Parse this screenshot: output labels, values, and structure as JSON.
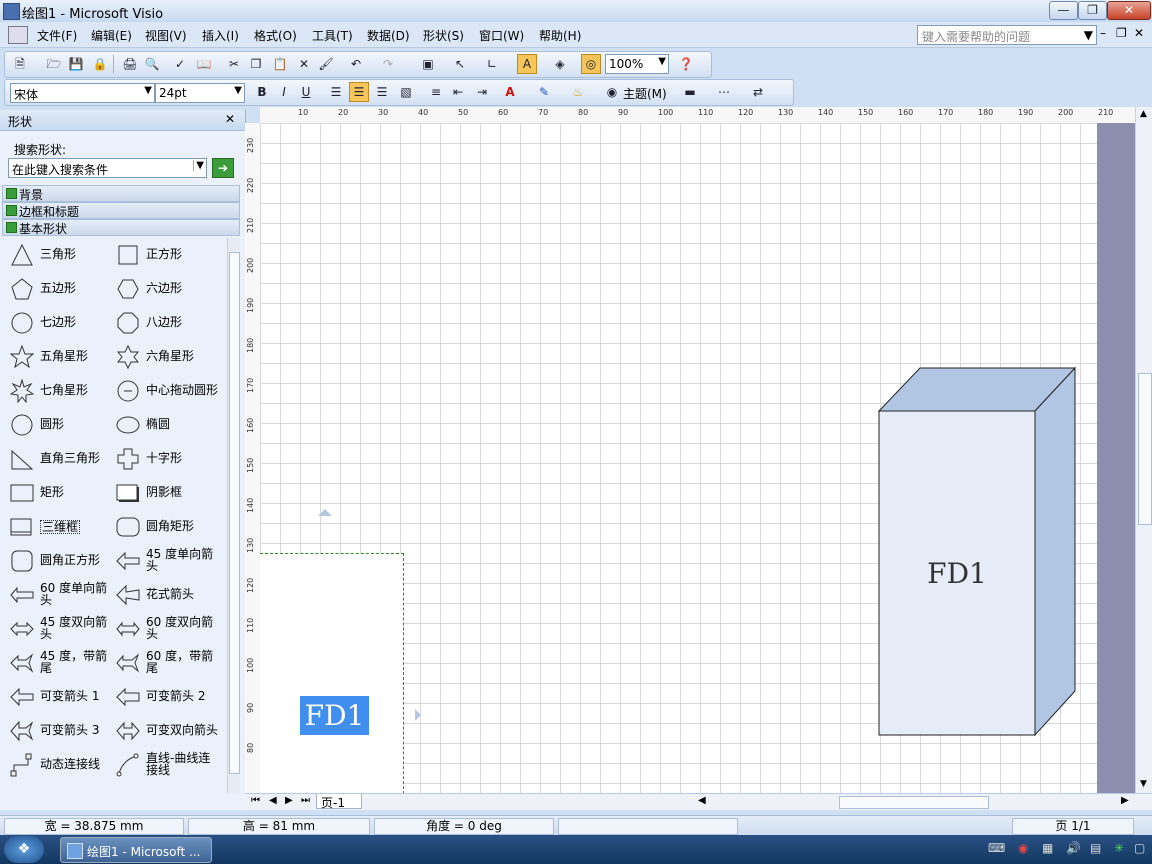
{
  "window": {
    "title": "绘图1 - Microsoft Visio"
  },
  "menu": {
    "items": [
      "文件(F)",
      "编辑(E)",
      "视图(V)",
      "插入(I)",
      "格式(O)",
      "工具(T)",
      "数据(D)",
      "形状(S)",
      "窗口(W)",
      "帮助(H)"
    ],
    "help_placeholder": "键入需要帮助的问题"
  },
  "toolbar": {
    "zoom": "100%",
    "font_name": "宋体",
    "font_size": "24pt",
    "theme_label": "主题(M)"
  },
  "panel": {
    "title": "形状",
    "search_label": "搜索形状:",
    "search_placeholder": "在此键入搜索条件",
    "stencils": [
      "背景",
      "边框和标题",
      "基本形状"
    ],
    "shapes": [
      {
        "l": "三角形",
        "r": "正方形"
      },
      {
        "l": "五边形",
        "r": "六边形"
      },
      {
        "l": "七边形",
        "r": "八边形"
      },
      {
        "l": "五角星形",
        "r": "六角星形"
      },
      {
        "l": "七角星形",
        "r": "中心拖动圆形"
      },
      {
        "l": "圆形",
        "r": "椭圆"
      },
      {
        "l": "直角三角形",
        "r": "十字形"
      },
      {
        "l": "矩形",
        "r": "阴影框"
      },
      {
        "l": "三维框",
        "r": "圆角矩形"
      },
      {
        "l": "圆角正方形",
        "r": "45 度单向箭头"
      },
      {
        "l": "60 度单向箭头",
        "r": "花式箭头"
      },
      {
        "l": "45 度双向箭头",
        "r": "60 度双向箭头"
      },
      {
        "l": "45 度，带箭尾",
        "r": "60 度，带箭尾"
      },
      {
        "l": "可变箭头 1",
        "r": "可变箭头 2"
      },
      {
        "l": "可变箭头 3",
        "r": "可变双向箭头"
      },
      {
        "l": "动态连接线",
        "r": "直线-曲线连接线"
      }
    ]
  },
  "ruler_h": [
    "10",
    "20",
    "30",
    "40",
    "50",
    "60",
    "70",
    "80",
    "90",
    "100",
    "110",
    "120",
    "130",
    "140",
    "150",
    "160",
    "170",
    "180",
    "190",
    "200",
    "210"
  ],
  "ruler_v": [
    "230",
    "220",
    "210",
    "200",
    "190",
    "180",
    "170",
    "160",
    "150",
    "140",
    "130",
    "120",
    "110",
    "100",
    "90",
    "80"
  ],
  "canvas": {
    "box_label": "FD1",
    "selected_text": "FD1"
  },
  "page_tab": "页-1",
  "status": {
    "width": "宽 = 38.875 mm",
    "height": "高 = 81 mm",
    "angle": "角度 = 0 deg",
    "page": "页 1/1"
  },
  "taskbar": {
    "task_label": "绘图1 - Microsoft ..."
  }
}
